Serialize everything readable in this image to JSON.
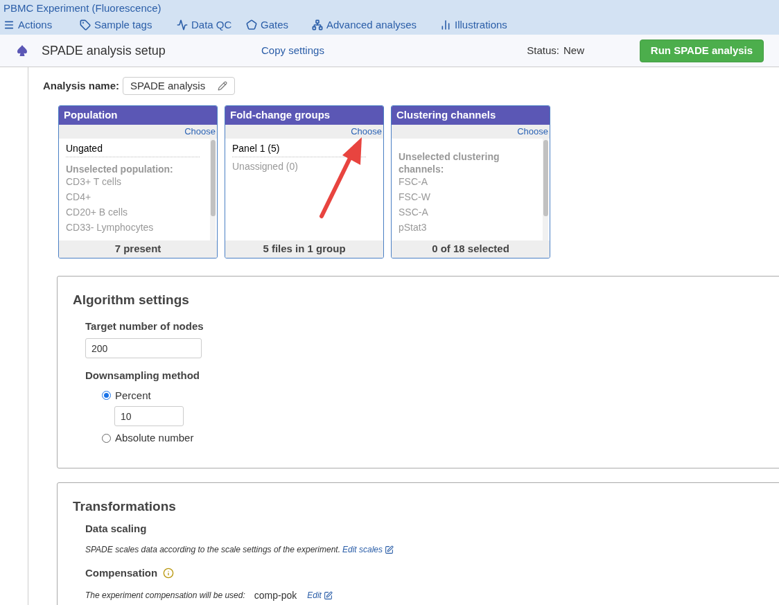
{
  "experiment_title": "PBMC Experiment (Fluorescence)",
  "nav": [
    {
      "label": "Actions"
    },
    {
      "label": "Sample tags"
    },
    {
      "label": "Data QC"
    },
    {
      "label": "Gates"
    },
    {
      "label": "Advanced analyses"
    },
    {
      "label": "Illustrations"
    }
  ],
  "setup": {
    "title": "SPADE analysis setup",
    "copy_link": "Copy settings",
    "status_label": "Status:",
    "status_value": "New",
    "run_button": "Run SPADE analysis"
  },
  "analysis_name": {
    "label": "Analysis name:",
    "value": "SPADE analysis"
  },
  "cards": [
    {
      "title": "Population",
      "action": "Choose",
      "items": [
        {
          "kind": "item",
          "selected": true,
          "text": "Ungated"
        },
        {
          "kind": "heading",
          "text": "Unselected population:"
        },
        {
          "kind": "item",
          "selected": false,
          "text": "CD3+ T cells"
        },
        {
          "kind": "item",
          "selected": false,
          "text": "CD4+"
        },
        {
          "kind": "item",
          "selected": false,
          "text": "CD20+ B cells"
        },
        {
          "kind": "item",
          "selected": false,
          "text": "CD33- Lymphocytes"
        }
      ],
      "footer": "7 present"
    },
    {
      "title": "Fold-change groups",
      "action": "Choose",
      "items": [
        {
          "kind": "item",
          "selected": true,
          "text": "Panel 1 (5)"
        },
        {
          "kind": "item",
          "selected": false,
          "text": "Unassigned (0)"
        }
      ],
      "footer": "5 files in 1 group"
    },
    {
      "title": "Clustering channels",
      "action": "Choose",
      "items": [
        {
          "kind": "heading",
          "text": "Unselected clustering channels:"
        },
        {
          "kind": "item",
          "selected": false,
          "text": "FSC-A"
        },
        {
          "kind": "item",
          "selected": false,
          "text": "FSC-W"
        },
        {
          "kind": "item",
          "selected": false,
          "text": "SSC-A"
        },
        {
          "kind": "item",
          "selected": false,
          "text": "pStat3"
        }
      ],
      "footer": "0 of 18 selected"
    }
  ],
  "algorithm": {
    "title": "Algorithm settings",
    "nodes_label": "Target number of nodes",
    "nodes_value": "200",
    "method_label": "Downsampling method",
    "methods": [
      {
        "label": "Percent",
        "selected": true,
        "value": "10"
      },
      {
        "label": "Absolute number",
        "selected": false
      }
    ]
  },
  "transformations": {
    "title": "Transformations",
    "scaling_label": "Data scaling",
    "scaling_text": "SPADE scales data according to the scale settings of the experiment.",
    "scaling_link": "Edit scales",
    "compensation_label": "Compensation",
    "compensation_text": "The experiment compensation will be used:",
    "compensation_value": "comp-pok",
    "compensation_link": "Edit"
  }
}
